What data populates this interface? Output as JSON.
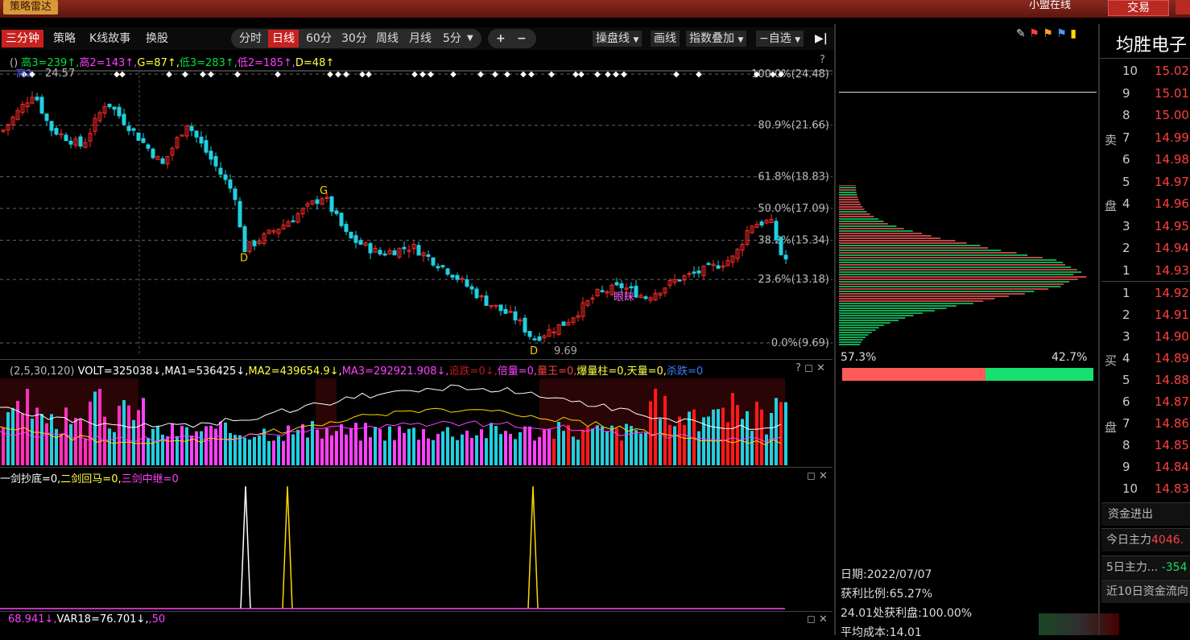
{
  "topbar": {
    "logo": "策略雷达",
    "alliance": "小盟在线",
    "trade": "交易"
  },
  "toolbar": {
    "left": [
      "三分钟",
      "策略",
      "K线故事",
      "换股"
    ],
    "periods": [
      "分时",
      "日线",
      "60分",
      "30分",
      "周线",
      "月线",
      "5分"
    ],
    "plus": "+",
    "minus": "−",
    "buttons": [
      "操盘线",
      "画线",
      "指数叠加",
      "自选"
    ]
  },
  "main_indicator": {
    "prefix": "()",
    "items": [
      {
        "text": "高3=239↑",
        "color": "#00e040"
      },
      {
        "text": "高2=143↑",
        "color": "#ff40ff"
      },
      {
        "text": "G=87↑",
        "color": "#ffff40"
      },
      {
        "text": "低3=283↑",
        "color": "#00e040"
      },
      {
        "text": "低2=185↑",
        "color": "#ff40ff"
      },
      {
        "text": "D=48↑",
        "color": "#ffff40"
      }
    ],
    "help": "?"
  },
  "price_chart": {
    "fib_levels": [
      {
        "label": "100.0%(24.48)",
        "price": 24.48
      },
      {
        "label": "80.9%(21.66)",
        "price": 21.66
      },
      {
        "label": "61.8%(18.83)",
        "price": 18.83
      },
      {
        "label": "50.0%(17.09)",
        "price": 17.09
      },
      {
        "label": "38.2%(15.34)",
        "price": 15.34
      },
      {
        "label": "23.6%(13.18)",
        "price": 13.18
      },
      {
        "label": "0.0%(9.69)",
        "price": 9.69
      }
    ],
    "high_label": "24.57",
    "high_tag": "高2",
    "low_label": "9.69",
    "markers": [
      {
        "text": "D",
        "color": "#ffcc00"
      },
      {
        "text": "G",
        "color": "#ffcc00"
      },
      {
        "text": "D",
        "color": "#ffcc00"
      },
      {
        "text": "眼睐",
        "color": "#ff60ff"
      }
    ]
  },
  "volume_indicator": {
    "prefix": "(2,5,30,120)",
    "items": [
      {
        "text": "VOLT=325038↓",
        "color": "#ffffff"
      },
      {
        "text": "MA1=536425↓",
        "color": "#ffffff"
      },
      {
        "text": "MA2=439654.9↓",
        "color": "#ffff40"
      },
      {
        "text": "MA3=292921.908↓",
        "color": "#ff40ff"
      },
      {
        "text": "追跌=0↓",
        "color": "#c01818"
      },
      {
        "text": "倍量=0",
        "color": "#ff40ff"
      },
      {
        "text": "量王=0",
        "color": "#ff4040"
      },
      {
        "text": "爆量柱=0",
        "color": "#ffff40"
      },
      {
        "text": "天量=0",
        "color": "#ffff40"
      },
      {
        "text": "杀跌=0",
        "color": "#3a7bff"
      }
    ]
  },
  "sword_indicator": {
    "items": [
      {
        "text": "一剑抄底=0",
        "color": "#ffffff"
      },
      {
        "text": "二剑回马=0",
        "color": "#ffff40"
      },
      {
        "text": "三剑中继=0",
        "color": "#ff40ff"
      }
    ]
  },
  "bottom_indicator": {
    "items": [
      {
        "text": "68.941↓",
        "color": "#ff40ff"
      },
      {
        "text": "VAR18=76.701↓",
        "color": "#ffffff"
      },
      {
        "text": ",50",
        "color": "#ff40ff"
      }
    ]
  },
  "chip_panel": {
    "left_pct": "57.3%",
    "right_pct": "42.7%"
  },
  "chip_info": [
    "日期:2022/07/07",
    "获利比例:65.27%",
    "24.01处获利盘:100.00%",
    "平均成本:14.01"
  ],
  "stock_name": "均胜电子",
  "orderbook": {
    "sell_label": [
      "卖",
      "盘"
    ],
    "buy_label": [
      "买",
      "盘"
    ],
    "sell": [
      {
        "level": "10",
        "price": "15.02"
      },
      {
        "level": "9",
        "price": "15.01"
      },
      {
        "level": "8",
        "price": "15.00"
      },
      {
        "level": "7",
        "price": "14.99"
      },
      {
        "level": "6",
        "price": "14.98"
      },
      {
        "level": "5",
        "price": "14.97"
      },
      {
        "level": "4",
        "price": "14.96"
      },
      {
        "level": "3",
        "price": "14.95"
      },
      {
        "level": "2",
        "price": "14.94"
      },
      {
        "level": "1",
        "price": "14.93"
      }
    ],
    "buy": [
      {
        "level": "1",
        "price": "14.92"
      },
      {
        "level": "2",
        "price": "14.91"
      },
      {
        "level": "3",
        "price": "14.90"
      },
      {
        "level": "4",
        "price": "14.89"
      },
      {
        "level": "5",
        "price": "14.88"
      },
      {
        "level": "6",
        "price": "14.87"
      },
      {
        "level": "7",
        "price": "14.86"
      },
      {
        "level": "8",
        "price": "14.85"
      },
      {
        "level": "9",
        "price": "14.84"
      },
      {
        "level": "10",
        "price": "14.83"
      }
    ]
  },
  "funds": {
    "title": "资金进出",
    "today_label": "今日主力",
    "today_value": "4046.",
    "five_label": "5日主力...",
    "five_value": "-354",
    "ten_label": "近10日资金流向"
  },
  "colors": {
    "up": "#ff2a2a",
    "down": "#1fd0e0",
    "up_vol": "#ff1a6a",
    "pink": "#ff40ff",
    "green": "#18e060",
    "yellow": "#ffd700"
  }
}
